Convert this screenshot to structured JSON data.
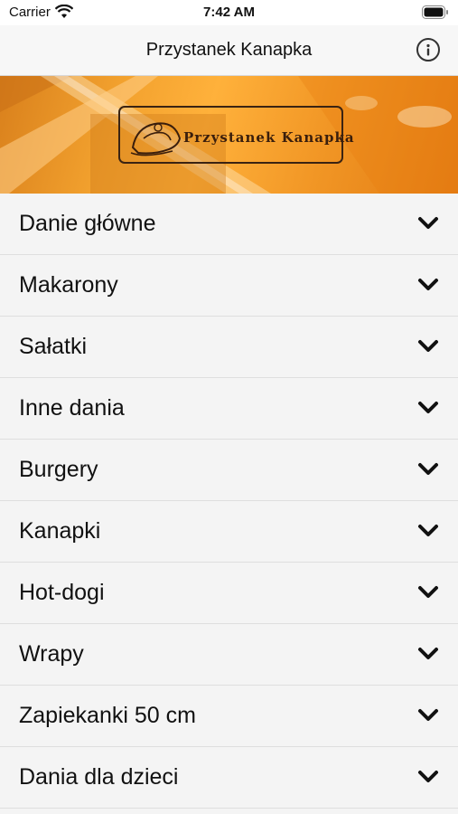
{
  "status_bar": {
    "carrier": "Carrier",
    "time": "7:42 AM"
  },
  "nav": {
    "title": "Przystanek Kanapka",
    "info_icon": "info-icon"
  },
  "banner": {
    "logo_text": "Przystanek Kanapka"
  },
  "menu": {
    "items": [
      {
        "label": "Danie główne"
      },
      {
        "label": "Makarony"
      },
      {
        "label": "Sałatki"
      },
      {
        "label": "Inne dania"
      },
      {
        "label": "Burgery"
      },
      {
        "label": "Kanapki"
      },
      {
        "label": "Hot-dogi"
      },
      {
        "label": "Wrapy"
      },
      {
        "label": "Zapiekanki 50 cm"
      },
      {
        "label": "Dania dla dzieci"
      }
    ]
  },
  "colors": {
    "banner_orange": "#f2a12e",
    "text": "#111111",
    "background": "#f4f4f4"
  }
}
